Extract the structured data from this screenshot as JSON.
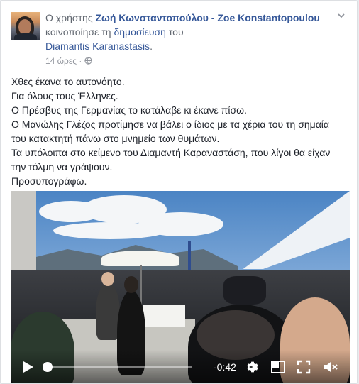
{
  "post": {
    "prefix": "Ο χρήστης",
    "author": "Ζωή Κωνσταντοπούλου - Zoe Konstantopoulou",
    "shared_text": "κοινοποίησε τη",
    "shared_link": "δημοσίευση",
    "of": "του",
    "original_author": "Diamantis Karanastasis",
    "period": ".",
    "time": "14 ώρες",
    "dot": "·",
    "lines": [
      "Χθες έκανα το αυτονόητο.",
      "Για όλους τους Έλληνες.",
      "Ο Πρέσβυς της Γερμανίας το κατάλαβε κι έκανε πίσω.",
      "Ο Μανώλης Γλέζος προτίμησε να βάλει ο ίδιος με τα χέρια του τη σημαία",
      "του κατακτητή πάνω στο μνημείο των θυμάτων.",
      "Τα υπόλοιπα στο κείμενο του Διαμαντή Καραναστάση, που λίγοι θα είχαν",
      "την τόλμη να γράψουν.",
      "Προσυπογράφω."
    ]
  },
  "video": {
    "time_remaining": "-0:42",
    "progress": 0.0
  },
  "icons": {
    "chevron": "chevron-down-icon",
    "globe": "globe-icon",
    "play": "play-icon",
    "settings": "gear-icon",
    "pip": "picture-in-picture-icon",
    "fullscreen": "fullscreen-icon",
    "mute": "mute-icon"
  },
  "colors": {
    "link": "#365899",
    "text": "#1d2129",
    "muted": "#616770",
    "meta": "#90949c"
  }
}
